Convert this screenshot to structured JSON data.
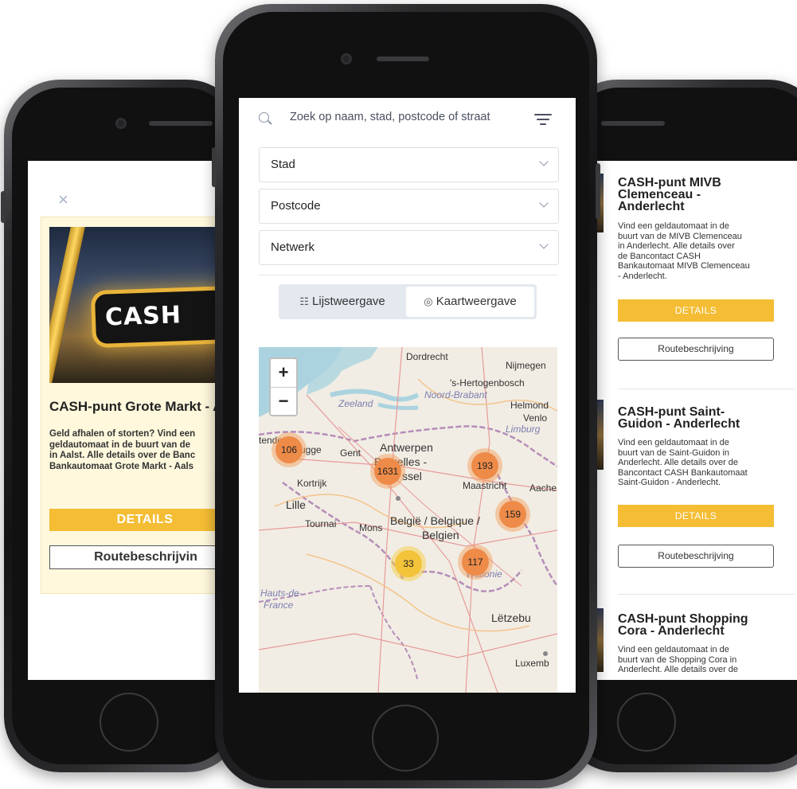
{
  "left_phone": {
    "close_symbol": "×",
    "card": {
      "image_sign_text": "CASH",
      "title": "CASH-punt Grote Markt - A",
      "text_lines": [
        "Geld afhalen of storten? Vind een",
        "geldautomaat in de buurt van de",
        "in Aalst. Alle details over de Banc",
        "Bankautomaat Grote Markt - Aals"
      ],
      "details_label": "DETAILS",
      "route_label": "Routebeschrijvin"
    }
  },
  "center_phone": {
    "search": {
      "placeholder": "Zoek op naam, stad, postcode of straat"
    },
    "filters": [
      {
        "label": "Stad"
      },
      {
        "label": "Postcode"
      },
      {
        "label": "Netwerk"
      }
    ],
    "view_toggle": {
      "list_label": "Lijstweergave",
      "map_label": "Kaartweergave",
      "list_icon": "list-icon",
      "map_icon": "location-pin-icon"
    },
    "map": {
      "zoom_in": "+",
      "zoom_out": "−",
      "clusters": [
        {
          "count": "106",
          "color": "orange"
        },
        {
          "count": "1631",
          "color": "orange"
        },
        {
          "count": "193",
          "color": "orange"
        },
        {
          "count": "159",
          "color": "orange"
        },
        {
          "count": "33",
          "color": "yellow"
        },
        {
          "count": "117",
          "color": "orange"
        }
      ],
      "labels": {
        "dordrecht": "Dordrecht",
        "nijmegen": "Nijmegen",
        "hertogenbosch": "'s-Hertogenbosch",
        "noord_brabant": "Noord-Brabant",
        "zeeland": "Zeeland",
        "helmond": "Helmond",
        "venlo": "Venlo",
        "limburg": "Limburg",
        "tende": "tende",
        "rugge": "rugge",
        "gent": "Gent",
        "antwerpen": "Antwerpen",
        "bruxelles": "Bruxelles -",
        "ssel": "ssel",
        "kortrijk": "Kortrijk",
        "maastricht": "Maastricht",
        "aachen": "Aache",
        "lille": "Lille",
        "tournai": "Tournai",
        "mons": "Mons",
        "belgie": "België / Belgique /",
        "belgien": "Belgien",
        "wallonie": "Wallonie",
        "hauts": "Hauts-de-",
        "france": "France",
        "letzebu": "Lëtzebu",
        "luxemb": "Luxemb"
      }
    }
  },
  "right_phone": {
    "items": [
      {
        "title_lines": [
          "CASH-punt MIVB",
          "Clemenceau -",
          "Anderlecht"
        ],
        "text_lines": [
          "Vind een geldautomaat in de",
          "buurt van de MIVB Clemenceau",
          "in Anderlecht. Alle details over",
          "de Bancontact CASH",
          "Bankautomaat MIVB Clemenceau",
          "- Anderlecht."
        ],
        "details_label": "DETAILS",
        "route_label": "Routebeschrijving"
      },
      {
        "title_lines": [
          "CASH-punt Saint-",
          "Guidon - Anderlecht"
        ],
        "text_lines": [
          "Vind een geldautomaat in de",
          "buurt van de Saint-Guidon in",
          "Anderlecht. Alle details over de",
          "Bancontact CASH Bankautomaat",
          "Saint-Guidon - Anderlecht."
        ],
        "details_label": "DETAILS",
        "route_label": "Routebeschrijving"
      },
      {
        "title_lines": [
          "CASH-punt Shopping",
          "Cora - Anderlecht"
        ],
        "text_lines": [
          "Vind een geldautomaat in de",
          "buurt van de Shopping Cora in",
          "Anderlecht. Alle details over de"
        ]
      }
    ]
  },
  "colors": {
    "accent_yellow": "#f4bd34",
    "card_background": "#fff8dd",
    "cluster_orange": "#ee8b48",
    "cluster_yellow": "#f3c33a"
  }
}
